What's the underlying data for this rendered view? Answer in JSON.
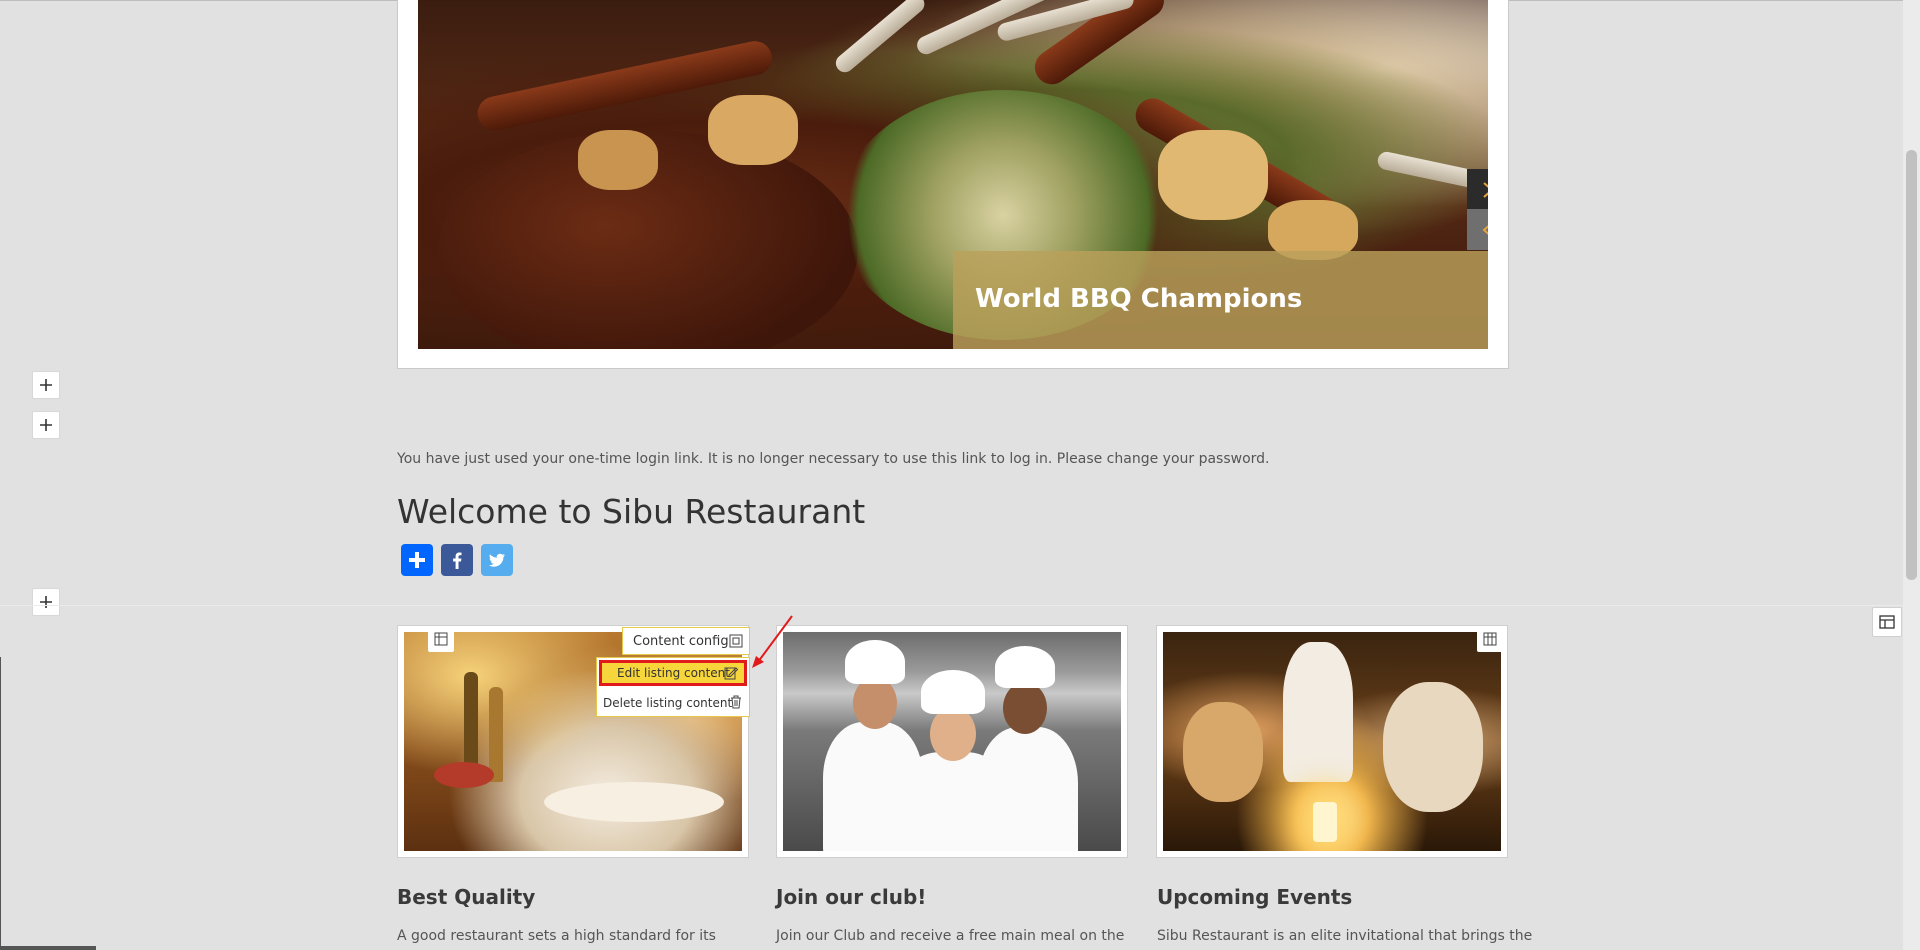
{
  "hero": {
    "caption": "World BBQ Champions",
    "next_icon": "chevron-right-icon",
    "prev_icon": "chevron-left-icon",
    "accent": "#e6a23c"
  },
  "message": "You have just used your one-time login link. It is no longer necessary to use this link to log in. Please change your password.",
  "welcome_title": "Welcome to Sibu Restaurant",
  "share": [
    {
      "name": "addthis",
      "icon": "plus-icon",
      "color": "#0166ff"
    },
    {
      "name": "facebook",
      "icon": "facebook-icon",
      "color": "#3b5998"
    },
    {
      "name": "twitter",
      "icon": "twitter-icon",
      "color": "#55acee"
    }
  ],
  "context_menu": {
    "config_label": "Content config",
    "edit_label": "Edit listing content",
    "delete_label": "Delete listing content",
    "highlight_color": "#f6d63b",
    "outline_color": "#e11b1b"
  },
  "cards": [
    {
      "title": "Best Quality",
      "text": "A good restaurant sets a high standard for its"
    },
    {
      "title": "Join our club!",
      "text": "Join our Club and receive a free main meal on the"
    },
    {
      "title": "Upcoming Events",
      "text": "Sibu Restaurant is an elite invitational that brings the"
    }
  ]
}
